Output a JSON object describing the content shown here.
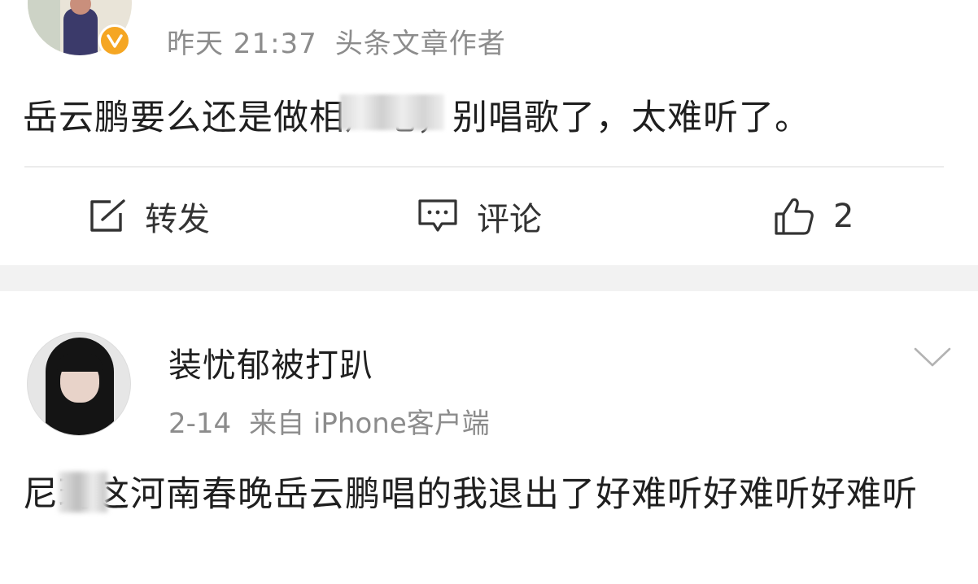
{
  "post1": {
    "time": "昨天 21:37",
    "tag": "头条文章作者",
    "content": "岳云鹏要么还是做相声吧，别唱歌了，太难听了。",
    "actions": {
      "repost_label": "转发",
      "comment_label": "评论",
      "like_count": "2"
    }
  },
  "post2": {
    "username": "装忧郁被打趴",
    "date": "2-14",
    "source": "来自 iPhone客户端",
    "content": "尼玛这河南春晚岳云鹏唱的我退出了好难听好难听好难听"
  },
  "colors": {
    "verified_badge": "#f5a623",
    "meta_text": "#8c8c8c",
    "separator": "#f2f2f2"
  },
  "icons": [
    "verified-icon",
    "repost-icon",
    "comment-icon",
    "like-icon",
    "chevron-down-icon"
  ]
}
